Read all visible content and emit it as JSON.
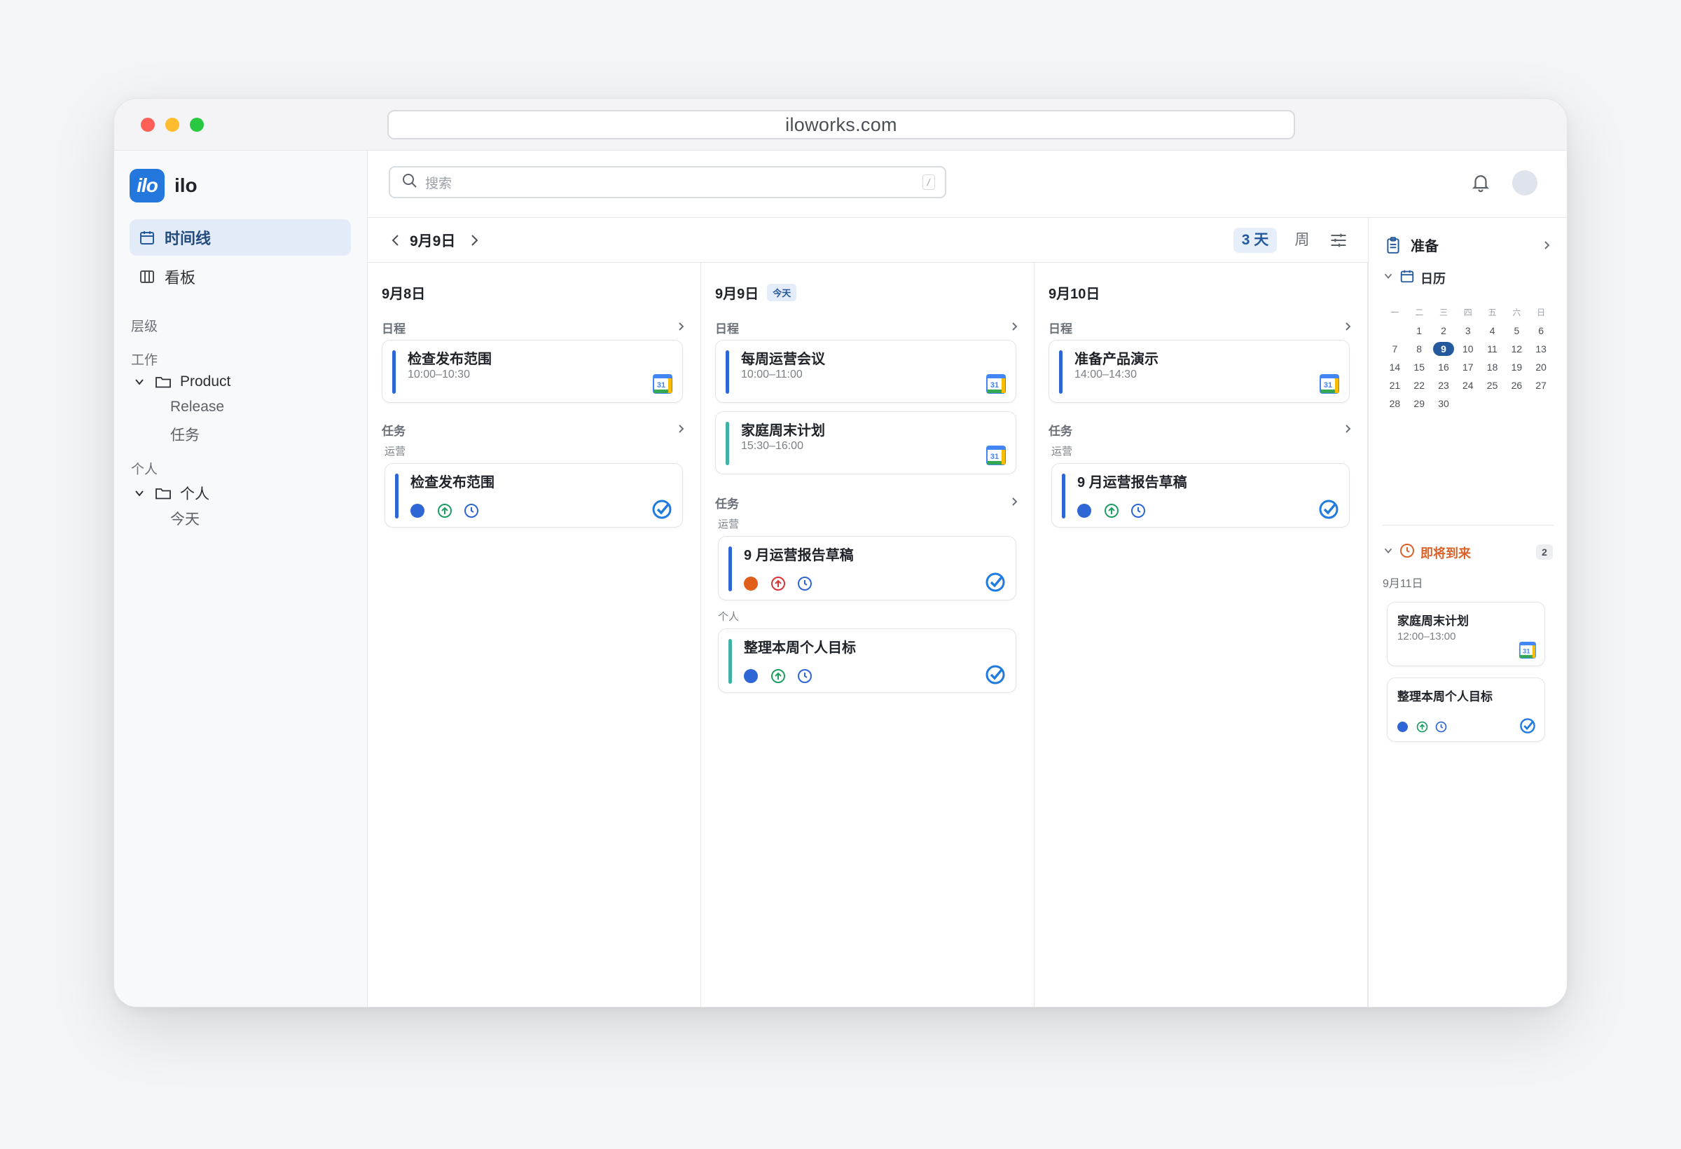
{
  "browser": {
    "url": "iloworks.com"
  },
  "app": {
    "logo_text": "ilo",
    "name": "ilo"
  },
  "colors": {
    "accent": "#2377dd",
    "blue_bar": "#2f66d6",
    "teal_bar": "#3fb1a6",
    "orange": "#e05e1a",
    "upcoming": "#d9632b"
  },
  "sidebar": {
    "nav": [
      {
        "label": "时间线",
        "icon": "calendar-icon",
        "active": true
      },
      {
        "label": "看板",
        "icon": "board-icon",
        "active": false
      }
    ],
    "hierarchy_label": "层级",
    "work_label": "工作",
    "work_folder": "Product",
    "work_children": [
      "Release",
      "任务"
    ],
    "personal_label": "个人",
    "personal_folder": "个人",
    "personal_children": [
      "今天"
    ]
  },
  "search": {
    "placeholder": "搜索",
    "shortcut": "/"
  },
  "toolbar": {
    "current_date": "9月9日",
    "view_3day": "3 天",
    "view_week": "周"
  },
  "columns": [
    {
      "date": "9月8日",
      "schedule_label": "日程",
      "events": [
        {
          "title": "检查发布范围",
          "time": "10:00–10:30"
        }
      ],
      "tasks_label": "任务",
      "task_groups": [
        {
          "group": "运营",
          "tasks": [
            {
              "title": "检查发布范围"
            }
          ]
        }
      ]
    },
    {
      "date": "9月9日",
      "today_badge": "今天",
      "schedule_label": "日程",
      "events": [
        {
          "title": "每周运营会议",
          "time": "10:00–11:00"
        },
        {
          "title": "家庭周末计划",
          "time": "15:30–16:00"
        }
      ],
      "tasks_label": "任务",
      "task_groups": [
        {
          "group": "运营",
          "tasks": [
            {
              "title": "9 月运营报告草稿"
            }
          ]
        },
        {
          "group": "个人",
          "tasks": [
            {
              "title": "整理本周个人目标"
            }
          ]
        }
      ]
    },
    {
      "date": "9月10日",
      "schedule_label": "日程",
      "events": [
        {
          "title": "准备产品演示",
          "time": "14:00–14:30"
        }
      ],
      "tasks_label": "任务",
      "task_groups": [
        {
          "group": "运营",
          "tasks": [
            {
              "title": "9 月运营报告草稿"
            }
          ]
        }
      ]
    }
  ],
  "right_panel": {
    "title": "准备",
    "calendar_label": "日历",
    "weekdays": [
      "一",
      "二",
      "三",
      "四",
      "五",
      "六",
      "日"
    ],
    "weeks": [
      [
        "",
        "1",
        "2",
        "3",
        "4",
        "5",
        "6"
      ],
      [
        "7",
        "8",
        "9",
        "10",
        "11",
        "12",
        "13"
      ],
      [
        "14",
        "15",
        "16",
        "17",
        "18",
        "19",
        "20"
      ],
      [
        "21",
        "22",
        "23",
        "24",
        "25",
        "26",
        "27"
      ],
      [
        "28",
        "29",
        "30",
        "",
        "",
        "",
        ""
      ]
    ],
    "selected_day": "9",
    "upcoming_label": "即将到来",
    "upcoming_count": "2",
    "upcoming_date": "9月11日",
    "upcoming_event": {
      "title": "家庭周末计划",
      "time": "12:00–13:00"
    },
    "upcoming_task": {
      "title": "整理本周个人目标"
    }
  }
}
